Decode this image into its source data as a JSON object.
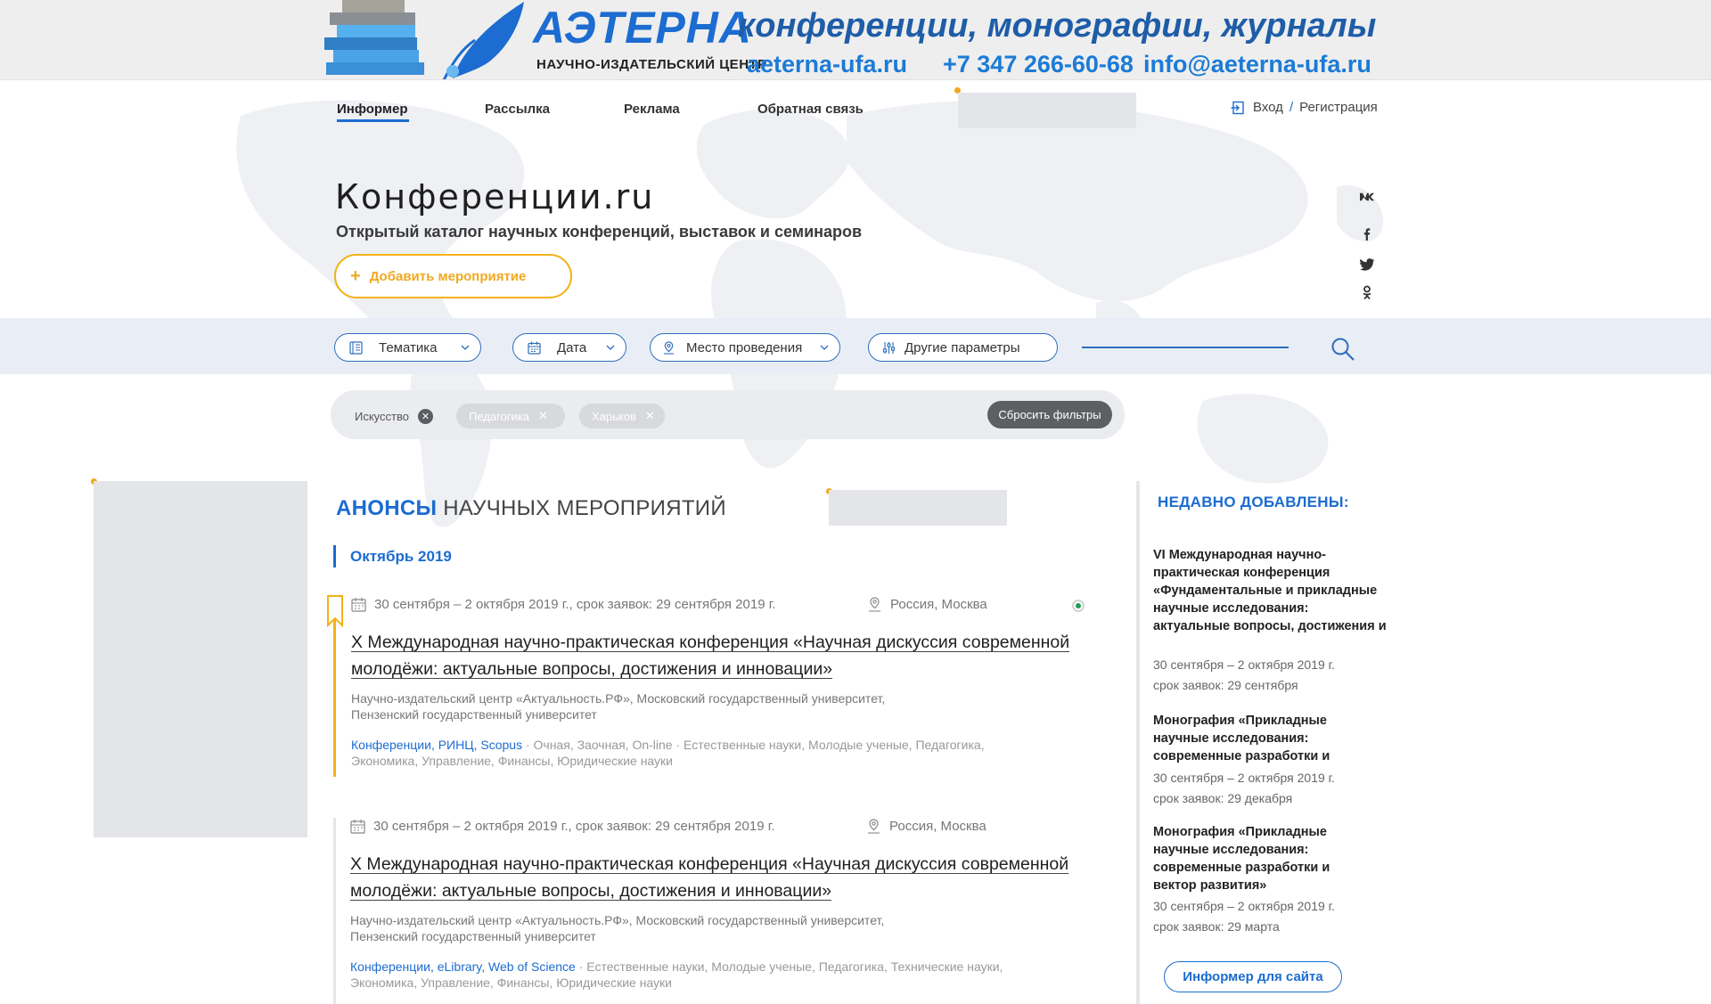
{
  "banner": {
    "logo": "АЭТЕРНА",
    "logo_sub": "НАУЧНО-ИЗДАТЕЛЬСКИЙ ЦЕНТР",
    "tagline": "конференции, монографии, журналы",
    "site": "aeterna-ufa.ru",
    "phone": "+7 347 266-60-68",
    "email": "info@aeterna-ufa.ru"
  },
  "nav": {
    "items": [
      "Информер",
      "Рассылка",
      "Реклама",
      "Обратная связь"
    ],
    "active": "Информер"
  },
  "auth": {
    "login": "Вход",
    "separator": "/",
    "register": "Регистрация"
  },
  "hero": {
    "title": "Конференции.ru",
    "subtitle": "Открытый каталог научных конференций, выставок и семинаров",
    "add_button": "Добавить мероприятие",
    "add_icon": "+"
  },
  "social": [
    "vk-icon",
    "facebook-icon",
    "twitter-icon",
    "odnoklassniki-icon"
  ],
  "social_glyphs": [
    "ᐯᴋ",
    "f",
    "🐦",
    "ok"
  ],
  "filters": {
    "topic": "Тематика",
    "date": "Дата",
    "place": "Место проведения",
    "other": "Другие параметры",
    "search_placeholder": ""
  },
  "active_tags": [
    {
      "label": "Искусство",
      "style": "plain"
    },
    {
      "label": "Педагогика",
      "style": "pill"
    },
    {
      "label": "Харьков",
      "style": "pill"
    }
  ],
  "reset_filters": "Сбросить фильтры",
  "announcements": {
    "title_strong": "АНОНСЫ",
    "title_rest": "НАУЧНЫХ МЕРОПРИЯТИЙ",
    "month": "Октябрь 2019"
  },
  "events": [
    {
      "dates": "30 сентября – 2 октября 2019 г., срок заявок: 29 сентября 2019 г.",
      "location": "Россия, Москва",
      "title": "X Международная научно-практическая конференция «Научная дискуссия современной молодёжи: актуальные вопросы, достижения и инновации»",
      "org_line1": "Научно-издательский центр «Актуальность.РФ», Московский государственный университет,",
      "org_line2": "Пензенский государственный университет",
      "tag_links": "Конференции, РИНЦ, Scopus",
      "tag_rest": " · Очная, Заочная, On-line · Естественные науки, Молодые ученые, Педагогика,",
      "tag_line2": "Экономика, Управление, Финансы, Юридические науки"
    },
    {
      "dates": "30 сентября – 2 октября 2019 г., срок заявок: 29 сентября 2019 г.",
      "location": "Россия, Москва",
      "title": "X Международная научно-практическая конференция «Научная дискуссия современной молодёжи: актуальные вопросы, достижения и инновации»",
      "org_line1": "Научно-издательский центр «Актуальность.РФ», Московский государственный университет,",
      "org_line2": "Пензенский государственный университет",
      "tag_links": "Конференции, eLibrary, Web of Science",
      "tag_rest": " · Естественные науки, Молодые ученые, Педагогика, Технические науки,",
      "tag_line2": "Экономика, Управление, Финансы, Юридические науки"
    }
  ],
  "sidebar": {
    "heading": "НЕДАВНО ДОБАВЛЕНЫ:",
    "items": [
      {
        "title": "VI Международная научно-практическая конференция «Фундаментальные и прикладные научные исследования: актуальные вопросы,  достижения и",
        "dates": "30 сентября – 2 октября 2019 г.",
        "deadline": "срок заявок: 29 сентября"
      },
      {
        "title": "Монография «Прикладные научные исследования: современные разработки и",
        "dates": "30 сентября – 2 октября 2019 г.",
        "deadline": "срок заявок: 29 декабря"
      },
      {
        "title": "Монография «Прикладные научные исследования: современные разработки и вектор развития»",
        "dates": "30 сентября – 2 октября 2019 г.",
        "deadline": "срок заявок: 29 марта"
      }
    ],
    "informer_button": "Информер для сайта"
  },
  "colors": {
    "accent_blue": "#1c6cd1",
    "accent_yellow": "#f4b117",
    "status_green": "#1ea04e"
  }
}
